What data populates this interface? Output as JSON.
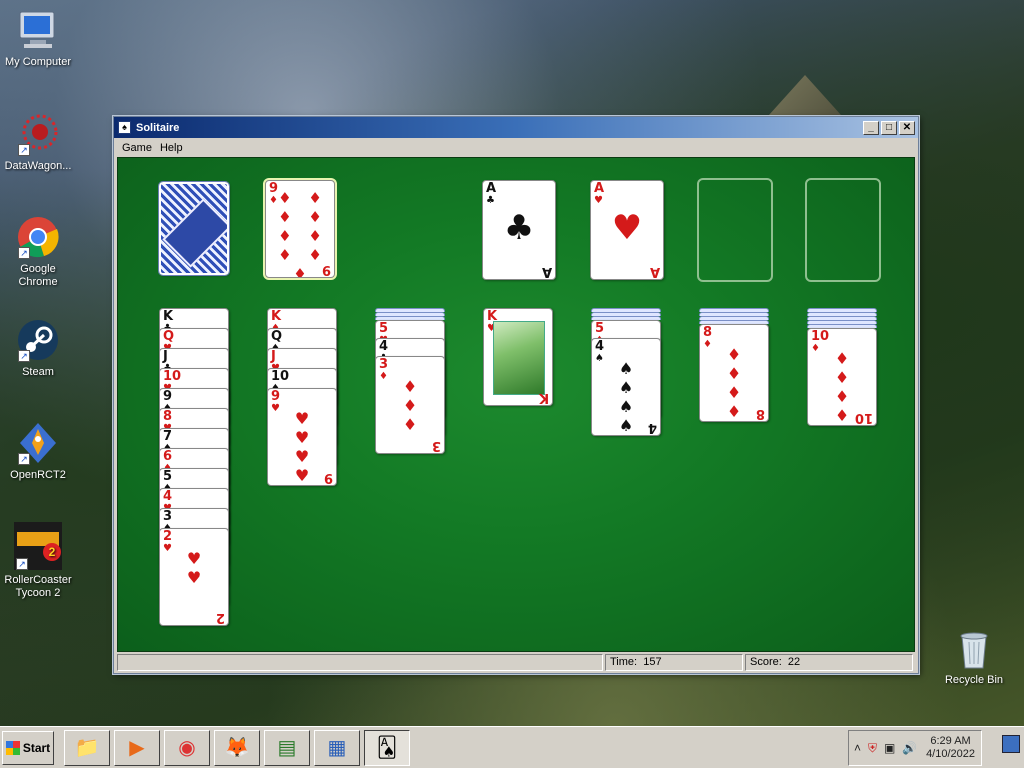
{
  "desktop": {
    "icons": [
      {
        "label": "My Computer",
        "glyph": "🖥"
      },
      {
        "label": "DataWagon...",
        "glyph": "✺"
      },
      {
        "label": "Google Chrome",
        "glyph": "◉"
      },
      {
        "label": "Steam",
        "glyph": "◎"
      },
      {
        "label": "OpenRCT2",
        "glyph": "🚀"
      },
      {
        "label": "RollerCoaster Tycoon 2",
        "glyph": "RCT2"
      }
    ],
    "recycle_bin": {
      "label": "Recycle Bin",
      "glyph": "🗑"
    }
  },
  "window": {
    "title": "Solitaire",
    "controls": {
      "minimize": "_",
      "maximize": "□",
      "close": "✕"
    },
    "menu": [
      "Game",
      "Help"
    ]
  },
  "game": {
    "waste_card": {
      "rank": "9",
      "suit": "♦",
      "color": "red"
    },
    "foundations": [
      {
        "rank": "A",
        "suit": "♣",
        "color": "black"
      },
      {
        "rank": "A",
        "suit": "♥",
        "color": "red"
      }
    ],
    "tableau": [
      {
        "visible": [
          {
            "rank": "K",
            "suit": "♣",
            "color": "black"
          },
          {
            "rank": "Q",
            "suit": "♥",
            "color": "red"
          },
          {
            "rank": "J",
            "suit": "♣",
            "color": "black"
          },
          {
            "rank": "10",
            "suit": "♥",
            "color": "red"
          },
          {
            "rank": "9",
            "suit": "♠",
            "color": "black"
          },
          {
            "rank": "8",
            "suit": "♥",
            "color": "red"
          },
          {
            "rank": "7",
            "suit": "♠",
            "color": "black"
          },
          {
            "rank": "6",
            "suit": "♦",
            "color": "red"
          },
          {
            "rank": "5",
            "suit": "♠",
            "color": "black"
          },
          {
            "rank": "4",
            "suit": "♥",
            "color": "red"
          },
          {
            "rank": "3",
            "suit": "♠",
            "color": "black"
          },
          {
            "rank": "2",
            "suit": "♥",
            "color": "red"
          }
        ]
      },
      {
        "visible": [
          {
            "rank": "K",
            "suit": "♦",
            "color": "red"
          },
          {
            "rank": "Q",
            "suit": "♠",
            "color": "black"
          },
          {
            "rank": "J",
            "suit": "♥",
            "color": "red"
          },
          {
            "rank": "10",
            "suit": "♠",
            "color": "black"
          },
          {
            "rank": "9",
            "suit": "♥",
            "color": "red"
          }
        ]
      },
      {
        "visible": [
          {
            "rank": "5",
            "suit": "♥",
            "color": "red"
          },
          {
            "rank": "4",
            "suit": "♣",
            "color": "black"
          },
          {
            "rank": "3",
            "suit": "♦",
            "color": "red"
          }
        ]
      },
      {
        "visible": [
          {
            "rank": "K",
            "suit": "♥",
            "color": "red"
          }
        ]
      },
      {
        "visible": [
          {
            "rank": "5",
            "suit": "♦",
            "color": "red"
          },
          {
            "rank": "4",
            "suit": "♠",
            "color": "black"
          }
        ]
      },
      {
        "visible": [
          {
            "rank": "8",
            "suit": "♦",
            "color": "red"
          }
        ]
      },
      {
        "visible": [
          {
            "rank": "10",
            "suit": "♦",
            "color": "red"
          }
        ]
      }
    ]
  },
  "status": {
    "time_label": "Time:",
    "time": "157",
    "score_label": "Score:",
    "score": "22"
  },
  "taskbar": {
    "start_label": "Start",
    "apps": [
      {
        "name": "file-explorer",
        "glyph": "📁"
      },
      {
        "name": "media-player",
        "glyph": "▶"
      },
      {
        "name": "chrome",
        "glyph": "◉"
      },
      {
        "name": "firefox",
        "glyph": "🦊"
      },
      {
        "name": "terminal",
        "glyph": "▤"
      },
      {
        "name": "control-panel",
        "glyph": "▦"
      },
      {
        "name": "solitaire",
        "glyph": "🂡"
      }
    ],
    "clock_time": "6:29 AM",
    "clock_date": "4/10/2022"
  }
}
